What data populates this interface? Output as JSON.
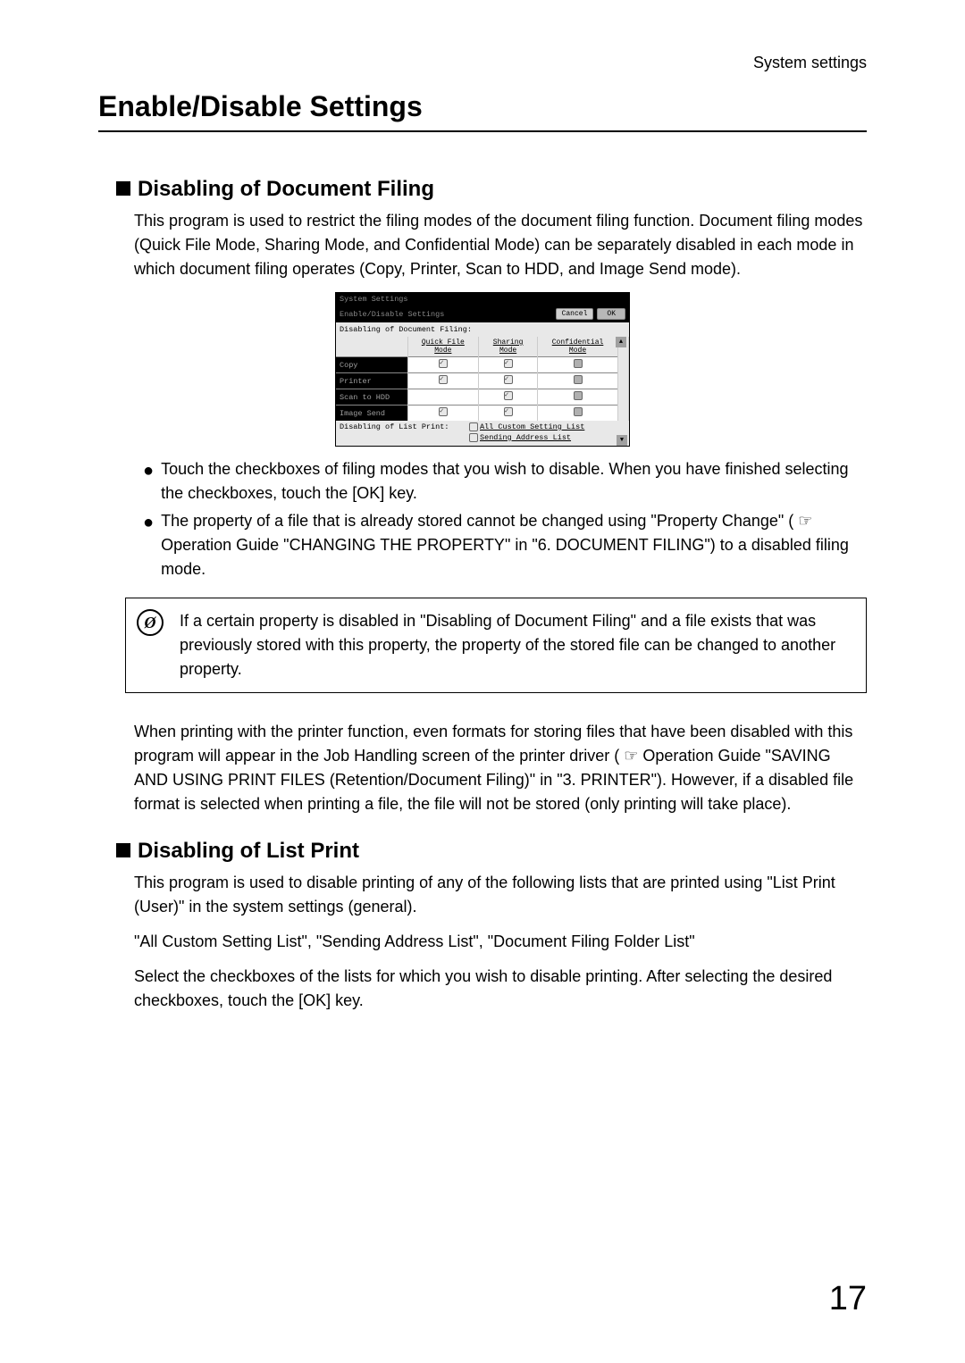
{
  "header": {
    "category": "System settings"
  },
  "page": {
    "title": "Enable/Disable Settings",
    "number": "17"
  },
  "section1": {
    "heading": "Disabling of Document Filing",
    "intro": "This program is used to restrict the filing modes of the document filing function. Document filing modes (Quick File Mode, Sharing Mode, and Confidential Mode) can be separately disabled in each mode in which document filing operates (Copy, Printer, Scan to HDD, and Image Send mode)."
  },
  "panel": {
    "titlebar": "System Settings",
    "header_label": "Enable/Disable Settings",
    "cancel": "Cancel",
    "ok": "OK",
    "section_label": "Disabling of Document Filing:",
    "columns": [
      "Quick File Mode",
      "Sharing Mode",
      "Confidential Mode"
    ],
    "rows": [
      {
        "label": "Copy",
        "c0": true,
        "c1": true,
        "c2": "gray"
      },
      {
        "label": "Printer",
        "c0": true,
        "c1": true,
        "c2": "gray"
      },
      {
        "label": "Scan to HDD",
        "c0": null,
        "c1": true,
        "c2": "gray"
      },
      {
        "label": "Image Send",
        "c0": true,
        "c1": true,
        "c2": "gray"
      }
    ],
    "list_print_label": "Disabling of List Print:",
    "list_items": [
      "All Custom Setting List",
      "Sending Address List"
    ]
  },
  "bullets": {
    "b1": "Touch the checkboxes of filing modes that you wish to disable. When you have finished selecting the checkboxes, touch the [OK] key.",
    "b2": "The property of a file that is already stored cannot be changed using \"Property Change\" ( ☞ Operation Guide \"CHANGING THE PROPERTY\" in \"6. DOCUMENT FILING\") to a disabled filing mode."
  },
  "note": {
    "text": "If a certain property is disabled in \"Disabling of Document Filing\" and a file exists that was previously stored with this property, the property of the stored file can be changed to another property."
  },
  "para2": "When printing with the printer function, even formats for storing files that have been disabled with this program will appear in the Job Handling screen of the printer driver ( ☞  Operation Guide \"SAVING AND USING PRINT FILES (Retention/Document Filing)\" in \"3. PRINTER\"). However, if a disabled file format is selected when printing a file, the file will not be stored (only printing will take place).",
  "section2": {
    "heading": "Disabling of List Print",
    "p1": "This program is used to disable printing of any of the following lists that are printed using \"List Print (User)\" in the system settings (general).",
    "p2": "\"All Custom Setting List\", \"Sending Address List\", \"Document Filing Folder List\"",
    "p3": "Select the checkboxes of the lists for which you wish to disable printing. After selecting the desired checkboxes, touch the [OK] key."
  }
}
